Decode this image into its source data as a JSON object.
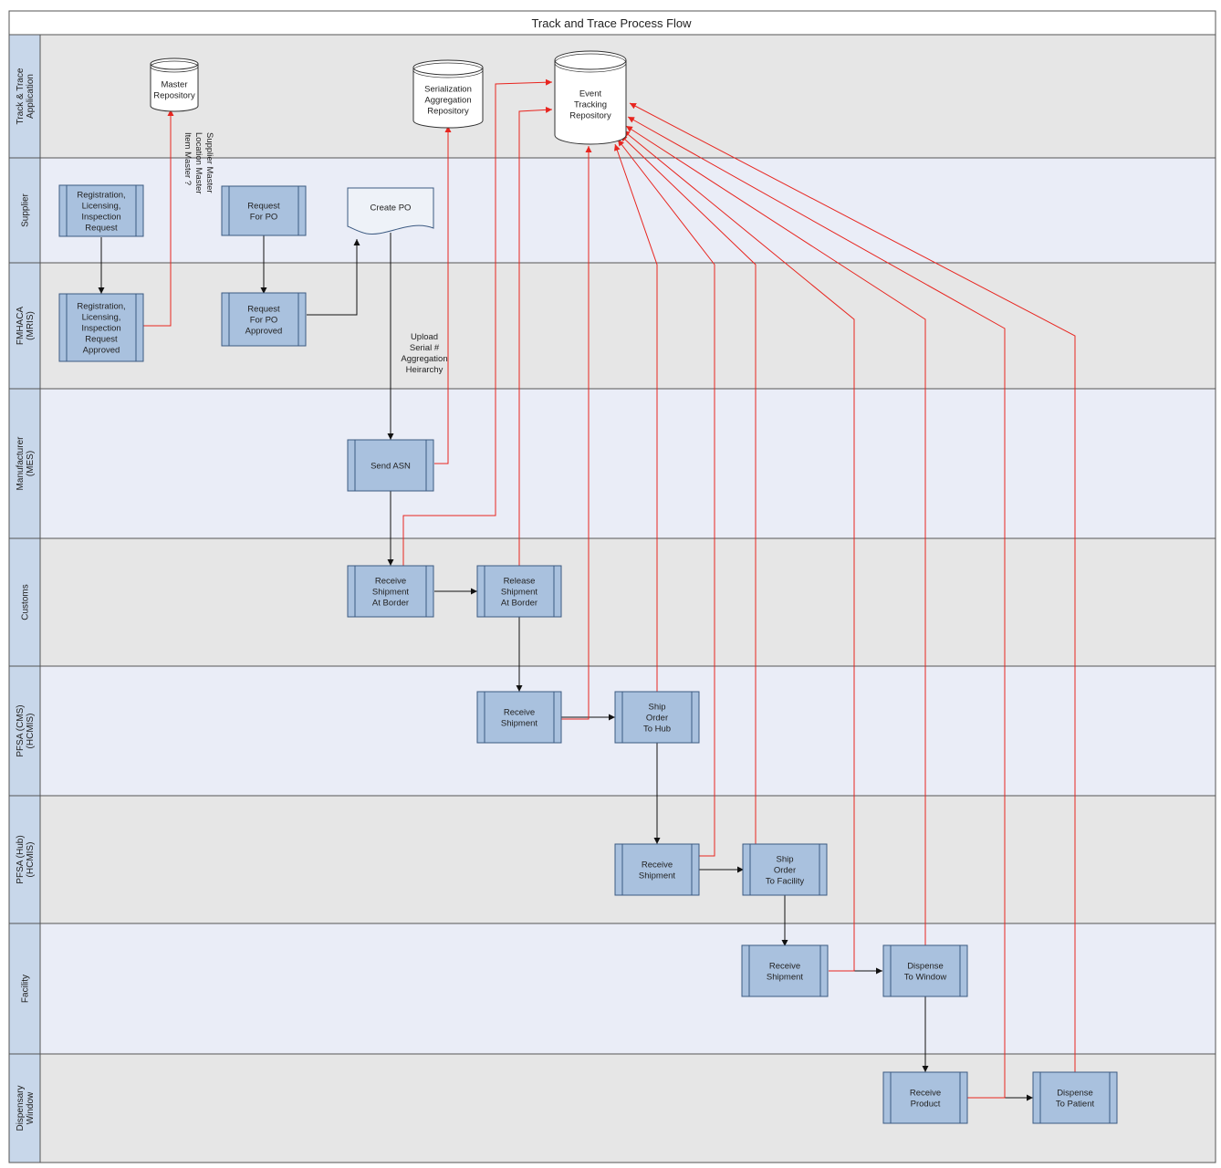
{
  "title": "Track and Trace Process Flow",
  "lanes": [
    {
      "id": "app",
      "label": [
        "Track & Trace",
        "Application"
      ],
      "band": "gray"
    },
    {
      "id": "supplier",
      "label": [
        "Supplier"
      ],
      "band": "blue"
    },
    {
      "id": "fmhaca",
      "label": [
        "FMHACA",
        "(MRIS)"
      ],
      "band": "gray"
    },
    {
      "id": "manufacturer",
      "label": [
        "Manufacturer",
        "(MES)"
      ],
      "band": "blue"
    },
    {
      "id": "customs",
      "label": [
        "Customs"
      ],
      "band": "gray"
    },
    {
      "id": "pfsa_cms",
      "label": [
        "PFSA (CMS)",
        "(HCMIS)"
      ],
      "band": "blue"
    },
    {
      "id": "pfsa_hub",
      "label": [
        "PFSA (Hub)",
        "(HCMIS)"
      ],
      "band": "gray"
    },
    {
      "id": "facility",
      "label": [
        "Facility"
      ],
      "band": "blue"
    },
    {
      "id": "dispensary",
      "label": [
        "Dispensary",
        "Window"
      ],
      "band": "gray"
    }
  ],
  "repositories": [
    {
      "id": "master",
      "lines": [
        "Master",
        "Repository"
      ]
    },
    {
      "id": "serial",
      "lines": [
        "Serialization",
        "Aggregation",
        "Repository"
      ]
    },
    {
      "id": "event",
      "lines": [
        "Event",
        "Tracking",
        "Repository"
      ]
    }
  ],
  "processes": [
    {
      "id": "reg_req",
      "lines": [
        "Registration,",
        "Licensing,",
        "Inspection",
        "Request"
      ]
    },
    {
      "id": "req_po",
      "lines": [
        "Request",
        "For PO"
      ]
    },
    {
      "id": "create_po",
      "lines": [
        "Create PO"
      ]
    },
    {
      "id": "reg_app",
      "lines": [
        "Registration,",
        "Licensing,",
        "Inspection",
        "Request",
        "Approved"
      ]
    },
    {
      "id": "po_app",
      "lines": [
        "Request",
        "For PO",
        "Approved"
      ]
    },
    {
      "id": "send_asn",
      "lines": [
        "Send ASN"
      ]
    },
    {
      "id": "recv_border",
      "lines": [
        "Receive",
        "Shipment",
        "At Border"
      ]
    },
    {
      "id": "rel_border",
      "lines": [
        "Release",
        "Shipment",
        "At Border"
      ]
    },
    {
      "id": "recv_cms",
      "lines": [
        "Receive",
        "Shipment"
      ]
    },
    {
      "id": "ship_hub",
      "lines": [
        "Ship",
        "Order",
        "To Hub"
      ]
    },
    {
      "id": "recv_hub",
      "lines": [
        "Receive",
        "Shipment"
      ]
    },
    {
      "id": "ship_fac",
      "lines": [
        "Ship",
        "Order",
        "To Facility"
      ]
    },
    {
      "id": "recv_fac",
      "lines": [
        "Receive",
        "Shipment"
      ]
    },
    {
      "id": "disp_win",
      "lines": [
        "Dispense",
        "To Window"
      ]
    },
    {
      "id": "recv_prod",
      "lines": [
        "Receive",
        "Product"
      ]
    },
    {
      "id": "disp_pat",
      "lines": [
        "Dispense",
        "To Patient"
      ]
    }
  ],
  "annotations": {
    "upload": [
      "Upload",
      "Serial #",
      "Aggregation",
      "Heirarchy"
    ],
    "supplier_master": [
      "Supplier Master",
      "Location Master",
      "Item Master ?"
    ]
  },
  "colors": {
    "process_fill": "#a9c1de",
    "process_stroke": "#3c5a82",
    "lane_gray": "#e6e6e6",
    "lane_blue": "#eaedf7",
    "label_col": "#c8d7ea",
    "black_arrow": "#111111",
    "red_arrow": "#e8251f"
  }
}
